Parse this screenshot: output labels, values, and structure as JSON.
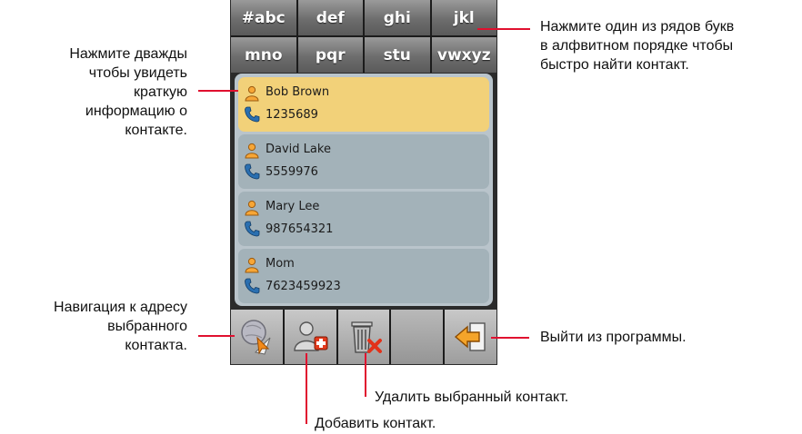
{
  "alphabet_buttons": [
    "#abc",
    "def",
    "ghi",
    "jkl",
    "mno",
    "pqr",
    "stu",
    "vwxyz"
  ],
  "contacts": [
    {
      "name": "Bob Brown",
      "phone": "1235689",
      "selected": true
    },
    {
      "name": "David Lake",
      "phone": "5559976",
      "selected": false
    },
    {
      "name": "Mary Lee",
      "phone": "987654321",
      "selected": false
    },
    {
      "name": "Mom",
      "phone": "7623459923",
      "selected": false
    }
  ],
  "toolbar": {
    "navigate_icon": "map-navigation-icon",
    "add_icon": "add-contact-icon",
    "delete_icon": "trash-delete-icon",
    "exit_icon": "exit-arrow-icon"
  },
  "callouts": {
    "alphabet_line1": "Нажмите один из рядов букв",
    "alphabet_line2": "в алфвитном порядке чтобы",
    "alphabet_line3": "быстро найти контакт.",
    "double_tap_line1": "Нажмите дважды",
    "double_tap_line2": "чтобы увидеть",
    "double_tap_line3": "краткую",
    "double_tap_line4": "информацию о",
    "double_tap_line5": "контакте.",
    "navigate_line1": "Навигация к адресу",
    "navigate_line2": "выбранного",
    "navigate_line3": "контакта.",
    "exit": "Выйти из программы.",
    "delete": "Удалить выбранный контакт.",
    "add": "Добавить контакт."
  },
  "colors": {
    "selected_row": "#f2d179",
    "row": "#a3b2b9",
    "callout_line": "#e0102f"
  }
}
